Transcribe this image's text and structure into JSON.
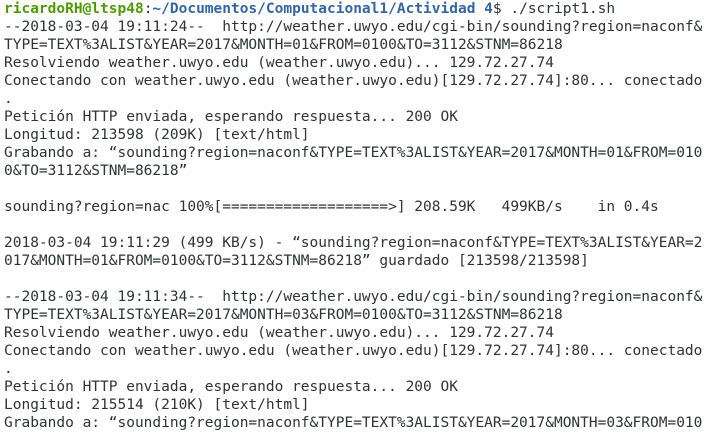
{
  "colors": {
    "background": "#ffffff",
    "text": "#2e3436",
    "prompt_user": "#4e9a06",
    "prompt_path": "#3465a4"
  },
  "prompt": {
    "user_host": "ricardoRH@ltsp48",
    "separator": ":",
    "path": "~/Documentos/Computacional1/Actividad 4",
    "symbol": "$ ",
    "command": "./script1.sh"
  },
  "lines": [
    "--2018-03-04 19:11:24--  http://weather.uwyo.edu/cgi-bin/sounding?region=naconf&",
    "TYPE=TEXT%3ALIST&YEAR=2017&MONTH=01&FROM=0100&TO=3112&STNM=86218",
    "Resolviendo weather.uwyo.edu (weather.uwyo.edu)... 129.72.27.74",
    "Conectando con weather.uwyo.edu (weather.uwyo.edu)[129.72.27.74]:80... conectado",
    ".",
    "Petición HTTP enviada, esperando respuesta... 200 OK",
    "Longitud: 213598 (209K) [text/html]",
    "Grabando a: “sounding?region=naconf&TYPE=TEXT%3ALIST&YEAR=2017&MONTH=01&FROM=010",
    "0&TO=3112&STNM=86218”",
    "",
    "sounding?region=nac 100%[===================>] 208.59K   499KB/s    in 0.4s",
    "",
    "2018-03-04 19:11:29 (499 KB/s) - “sounding?region=naconf&TYPE=TEXT%3ALIST&YEAR=2",
    "017&MONTH=01&FROM=0100&TO=3112&STNM=86218” guardado [213598/213598]",
    "",
    "--2018-03-04 19:11:34--  http://weather.uwyo.edu/cgi-bin/sounding?region=naconf&",
    "TYPE=TEXT%3ALIST&YEAR=2017&MONTH=03&FROM=0100&TO=3112&STNM=86218",
    "Resolviendo weather.uwyo.edu (weather.uwyo.edu)... 129.72.27.74",
    "Conectando con weather.uwyo.edu (weather.uwyo.edu)[129.72.27.74]:80... conectado",
    ".",
    "Petición HTTP enviada, esperando respuesta... 200 OK",
    "Longitud: 215514 (210K) [text/html]",
    "Grabando a: “sounding?region=naconf&TYPE=TEXT%3ALIST&YEAR=2017&MONTH=03&FROM=010"
  ]
}
